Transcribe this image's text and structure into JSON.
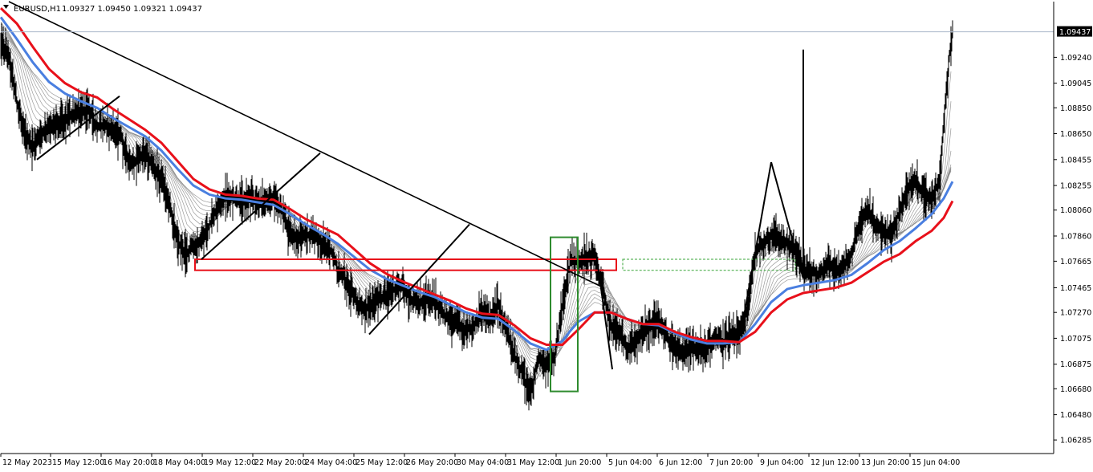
{
  "header": {
    "symbol": "EURUSD,H1",
    "ohlc": "1.09327 1.09450 1.09321 1.09437"
  },
  "colors": {
    "background": "#ffffff",
    "axis": "#000000",
    "price_line": "#a9b6c9",
    "price_tag_bg": "#000000",
    "price_tag_text": "#ffffff",
    "bars": "#000000",
    "ribbon": "#8a8a8a",
    "ema_blue": "#4a7fe0",
    "ema_red": "#e8101a",
    "trendline": "#000000",
    "zone_red": "#e8101a",
    "zone_green_box": "#2e8b2e",
    "dotted_green": "#3aa53a"
  },
  "chart_data": {
    "type": "candlestick",
    "title": "EURUSD,H1",
    "last_price": 1.09437,
    "ylim": [
      1.0618,
      1.0967
    ],
    "y_ticks": [
      1.0924,
      1.0904,
      1.0885,
      1.0865,
      1.0845,
      1.0825,
      1.0806,
      1.0786,
      1.07665,
      1.0746,
      1.0727,
      1.0707,
      1.0687,
      1.0668,
      1.0648,
      1.06285
    ],
    "y_tick_labels": [
      "1.09240",
      "1.09045",
      "1.08850",
      "1.08650",
      "1.08455",
      "1.08255",
      "1.08060",
      "1.07860",
      "1.07665",
      "1.07465",
      "1.07270",
      "1.07075",
      "1.06875",
      "1.06680",
      "1.06480",
      "1.06285"
    ],
    "x_ticks": [
      0,
      62,
      125,
      188,
      251,
      314,
      377,
      440,
      503,
      566,
      629,
      692,
      755,
      818,
      881,
      944,
      1007,
      1070,
      1133
    ],
    "x_tick_labels": [
      "12 May 2023",
      "15 May 12:00",
      "16 May 20:00",
      "18 May 04:00",
      "19 May 12:00",
      "22 May 20:00",
      "24 May 04:00",
      "25 May 12:00",
      "26 May 20:00",
      "30 May 04:00",
      "31 May 12:00",
      "1 Jun 20:00",
      "5 Jun 04:00",
      "6 Jun 12:00",
      "7 Jun 20:00",
      "9 Jun 04:00",
      "12 Jun 12:00",
      "13 Jun 20:00",
      "15 Jun 04:00"
    ],
    "close_path": [
      [
        0,
        1.0935
      ],
      [
        10,
        1.0925
      ],
      [
        20,
        1.089
      ],
      [
        30,
        1.0862
      ],
      [
        40,
        1.0855
      ],
      [
        50,
        1.0866
      ],
      [
        60,
        1.087
      ],
      [
        70,
        1.0873
      ],
      [
        80,
        1.0876
      ],
      [
        90,
        1.088
      ],
      [
        100,
        1.0882
      ],
      [
        110,
        1.0885
      ],
      [
        120,
        1.087
      ],
      [
        130,
        1.0872
      ],
      [
        140,
        1.0868
      ],
      [
        150,
        1.0862
      ],
      [
        160,
        1.084
      ],
      [
        170,
        1.0845
      ],
      [
        180,
        1.085
      ],
      [
        190,
        1.084
      ],
      [
        200,
        1.083
      ],
      [
        210,
        1.0812
      ],
      [
        220,
        1.0782
      ],
      [
        230,
        1.0773
      ],
      [
        240,
        1.0778
      ],
      [
        250,
        1.078
      ],
      [
        260,
        1.0795
      ],
      [
        270,
        1.0808
      ],
      [
        280,
        1.0817
      ],
      [
        290,
        1.0815
      ],
      [
        300,
        1.0812
      ],
      [
        310,
        1.0815
      ],
      [
        320,
        1.0813
      ],
      [
        330,
        1.0812
      ],
      [
        340,
        1.0815
      ],
      [
        350,
        1.0805
      ],
      [
        360,
        1.0788
      ],
      [
        370,
        1.0783
      ],
      [
        380,
        1.0786
      ],
      [
        390,
        1.0788
      ],
      [
        400,
        1.078
      ],
      [
        410,
        1.0776
      ],
      [
        420,
        1.076
      ],
      [
        430,
        1.0752
      ],
      [
        440,
        1.074
      ],
      [
        450,
        1.0728
      ],
      [
        460,
        1.0732
      ],
      [
        470,
        1.0737
      ],
      [
        480,
        1.074
      ],
      [
        490,
        1.0745
      ],
      [
        500,
        1.0748
      ],
      [
        510,
        1.0738
      ],
      [
        520,
        1.0733
      ],
      [
        530,
        1.0738
      ],
      [
        540,
        1.0735
      ],
      [
        550,
        1.0728
      ],
      [
        560,
        1.072
      ],
      [
        570,
        1.0718
      ],
      [
        580,
        1.0713
      ],
      [
        590,
        1.0716
      ],
      [
        600,
        1.0728
      ],
      [
        610,
        1.0723
      ],
      [
        620,
        1.0733
      ],
      [
        630,
        1.0713
      ],
      [
        640,
        1.0693
      ],
      [
        650,
        1.068
      ],
      [
        660,
        1.0663
      ],
      [
        670,
        1.0693
      ],
      [
        680,
        1.0685
      ],
      [
        690,
        1.0693
      ],
      [
        700,
        1.0733
      ],
      [
        710,
        1.0768
      ],
      [
        720,
        1.0766
      ],
      [
        730,
        1.077
      ],
      [
        740,
        1.077
      ],
      [
        750,
        1.0745
      ],
      [
        760,
        1.0718
      ],
      [
        770,
        1.0713
      ],
      [
        780,
        1.0698
      ],
      [
        790,
        1.0703
      ],
      [
        800,
        1.0713
      ],
      [
        810,
        1.0718
      ],
      [
        820,
        1.0718
      ],
      [
        830,
        1.0708
      ],
      [
        840,
        1.0698
      ],
      [
        850,
        1.0695
      ],
      [
        860,
        1.07
      ],
      [
        870,
        1.0697
      ],
      [
        880,
        1.07
      ],
      [
        890,
        1.0708
      ],
      [
        900,
        1.0703
      ],
      [
        910,
        1.0708
      ],
      [
        920,
        1.071
      ],
      [
        930,
        1.0728
      ],
      [
        940,
        1.0773
      ],
      [
        950,
        1.078
      ],
      [
        960,
        1.0786
      ],
      [
        970,
        1.0784
      ],
      [
        980,
        1.078
      ],
      [
        990,
        1.0775
      ],
      [
        1000,
        1.076
      ],
      [
        1010,
        1.0758
      ],
      [
        1020,
        1.0755
      ],
      [
        1030,
        1.0766
      ],
      [
        1040,
        1.076
      ],
      [
        1050,
        1.0762
      ],
      [
        1060,
        1.0773
      ],
      [
        1070,
        1.0795
      ],
      [
        1080,
        1.0806
      ],
      [
        1090,
        1.0795
      ],
      [
        1100,
        1.079
      ],
      [
        1110,
        1.0786
      ],
      [
        1120,
        1.0806
      ],
      [
        1130,
        1.0823
      ],
      [
        1140,
        1.0828
      ],
      [
        1150,
        1.0818
      ],
      [
        1160,
        1.0813
      ],
      [
        1170,
        1.083
      ],
      [
        1178,
        1.0895
      ],
      [
        1182,
        1.0925
      ],
      [
        1186,
        1.09437
      ]
    ],
    "ema_blue": [
      [
        0,
        1.0955
      ],
      [
        20,
        1.0938
      ],
      [
        40,
        1.092
      ],
      [
        60,
        1.0905
      ],
      [
        80,
        1.0896
      ],
      [
        100,
        1.089
      ],
      [
        120,
        1.0885
      ],
      [
        140,
        1.0877
      ],
      [
        160,
        1.087
      ],
      [
        180,
        1.0863
      ],
      [
        200,
        1.0852
      ],
      [
        220,
        1.0838
      ],
      [
        240,
        1.0825
      ],
      [
        260,
        1.0818
      ],
      [
        280,
        1.0815
      ],
      [
        300,
        1.0814
      ],
      [
        320,
        1.0812
      ],
      [
        340,
        1.081
      ],
      [
        360,
        1.0803
      ],
      [
        380,
        1.0795
      ],
      [
        400,
        1.0788
      ],
      [
        420,
        1.078
      ],
      [
        440,
        1.077
      ],
      [
        460,
        1.076
      ],
      [
        480,
        1.0753
      ],
      [
        500,
        1.0748
      ],
      [
        520,
        1.0743
      ],
      [
        540,
        1.0739
      ],
      [
        560,
        1.0733
      ],
      [
        580,
        1.0727
      ],
      [
        600,
        1.0723
      ],
      [
        620,
        1.0722
      ],
      [
        640,
        1.0713
      ],
      [
        660,
        1.0703
      ],
      [
        680,
        1.0698
      ],
      [
        700,
        1.0705
      ],
      [
        710,
        1.0713
      ],
      [
        720,
        1.072
      ],
      [
        740,
        1.0727
      ],
      [
        760,
        1.0727
      ],
      [
        780,
        1.0722
      ],
      [
        800,
        1.0718
      ],
      [
        820,
        1.0717
      ],
      [
        840,
        1.0711
      ],
      [
        860,
        1.0706
      ],
      [
        880,
        1.0703
      ],
      [
        900,
        1.0703
      ],
      [
        920,
        1.0704
      ],
      [
        940,
        1.0718
      ],
      [
        960,
        1.0735
      ],
      [
        980,
        1.0745
      ],
      [
        1000,
        1.0748
      ],
      [
        1020,
        1.075
      ],
      [
        1040,
        1.0752
      ],
      [
        1060,
        1.0756
      ],
      [
        1080,
        1.0765
      ],
      [
        1100,
        1.0775
      ],
      [
        1120,
        1.0782
      ],
      [
        1140,
        1.0792
      ],
      [
        1160,
        1.0803
      ],
      [
        1175,
        1.0815
      ],
      [
        1186,
        1.0828
      ]
    ],
    "ema_red": [
      [
        0,
        1.0962
      ],
      [
        20,
        1.095
      ],
      [
        40,
        1.0932
      ],
      [
        60,
        1.0915
      ],
      [
        80,
        1.0904
      ],
      [
        100,
        1.0897
      ],
      [
        120,
        1.0893
      ],
      [
        140,
        1.0884
      ],
      [
        160,
        1.0876
      ],
      [
        180,
        1.0868
      ],
      [
        200,
        1.0858
      ],
      [
        220,
        1.0844
      ],
      [
        240,
        1.083
      ],
      [
        260,
        1.0822
      ],
      [
        280,
        1.0818
      ],
      [
        300,
        1.0817
      ],
      [
        320,
        1.0815
      ],
      [
        340,
        1.0814
      ],
      [
        360,
        1.0807
      ],
      [
        380,
        1.0799
      ],
      [
        400,
        1.0793
      ],
      [
        420,
        1.0787
      ],
      [
        440,
        1.0776
      ],
      [
        460,
        1.0765
      ],
      [
        480,
        1.0757
      ],
      [
        500,
        1.0751
      ],
      [
        520,
        1.0746
      ],
      [
        540,
        1.0741
      ],
      [
        560,
        1.0736
      ],
      [
        580,
        1.073
      ],
      [
        600,
        1.0726
      ],
      [
        620,
        1.0725
      ],
      [
        640,
        1.0717
      ],
      [
        660,
        1.0707
      ],
      [
        680,
        1.0702
      ],
      [
        700,
        1.0702
      ],
      [
        720,
        1.0714
      ],
      [
        740,
        1.0727
      ],
      [
        760,
        1.0727
      ],
      [
        780,
        1.0722
      ],
      [
        800,
        1.0718
      ],
      [
        820,
        1.0718
      ],
      [
        840,
        1.0712
      ],
      [
        860,
        1.0708
      ],
      [
        880,
        1.0705
      ],
      [
        900,
        1.0705
      ],
      [
        920,
        1.0704
      ],
      [
        940,
        1.0712
      ],
      [
        960,
        1.0727
      ],
      [
        980,
        1.0737
      ],
      [
        1000,
        1.0742
      ],
      [
        1020,
        1.0744
      ],
      [
        1040,
        1.0746
      ],
      [
        1060,
        1.075
      ],
      [
        1080,
        1.0758
      ],
      [
        1100,
        1.0766
      ],
      [
        1120,
        1.0772
      ],
      [
        1140,
        1.0782
      ],
      [
        1160,
        1.079
      ],
      [
        1175,
        1.08
      ],
      [
        1186,
        1.0813
      ]
    ],
    "zones": [
      {
        "kind": "red-box",
        "x0": 242,
        "x1": 767,
        "y_top": 1.0768,
        "y_bottom": 1.07595
      },
      {
        "kind": "green-box",
        "x0": 685,
        "x1": 719,
        "y_top": 1.0785,
        "y_bottom": 1.0666
      },
      {
        "kind": "green-dotted",
        "x0": 775,
        "x1": 990,
        "y_top": 1.0768,
        "y_bottom": 1.07595
      }
    ],
    "trendlines": [
      [
        [
          10,
          1.0967
        ],
        [
          748,
          1.0747
        ]
      ],
      [
        [
          45,
          1.0845
        ],
        [
          148,
          1.0894
        ]
      ],
      [
        [
          250,
          1.0768
        ],
        [
          398,
          1.085
        ]
      ],
      [
        [
          459,
          1.071
        ],
        [
          584,
          1.0795
        ]
      ],
      [
        [
          742,
          1.0772
        ],
        [
          762,
          1.0683
        ]
      ],
      [
        [
          922,
          1.071
        ],
        [
          960,
          1.0843
        ]
      ],
      [
        [
          960,
          1.0843
        ],
        [
          1000,
          1.0753
        ]
      ],
      [
        [
          1000,
          1.0753
        ],
        [
          1000,
          1.093
        ]
      ]
    ]
  }
}
